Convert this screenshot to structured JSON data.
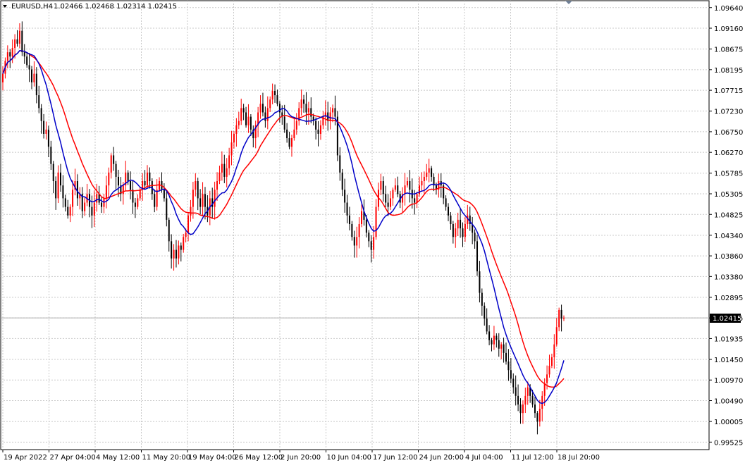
{
  "chart_data": {
    "type": "candlestick",
    "title": "EURUSD,H4",
    "ohlc_label": "1.02466 1.02468 1.02314 1.02415",
    "last_price": "1.02415",
    "ylim": [
      0.9935,
      1.098
    ],
    "y_ticks": [
      "1.09640",
      "1.09160",
      "1.08675",
      "1.08195",
      "1.07715",
      "1.07230",
      "1.06750",
      "1.06270",
      "1.05785",
      "1.05305",
      "1.04825",
      "1.04340",
      "1.03860",
      "1.03380",
      "1.02895",
      "1.02415",
      "1.01935",
      "1.01450",
      "1.00970",
      "1.00490",
      "1.00005",
      "0.99525"
    ],
    "x_ticks": [
      "19 Apr 2022",
      "27 Apr 04:00",
      "4 May 12:00",
      "11 May 20:00",
      "19 May 04:00",
      "26 May 12:00",
      "2 Jun 20:00",
      "10 Jun 04:00",
      "17 Jun 12:00",
      "24 Jun 20:00",
      "4 Jul 04:00",
      "11 Jul 12:00",
      "18 Jul 20:00"
    ],
    "grid": true,
    "up_color": "#ff0000",
    "down_color": "#000000",
    "close_series": [
      1.081,
      1.084,
      1.086,
      1.085,
      1.087,
      1.089,
      1.088,
      1.091,
      1.086,
      1.085,
      1.083,
      1.082,
      1.079,
      1.081,
      1.076,
      1.073,
      1.07,
      1.067,
      1.068,
      1.064,
      1.06,
      1.056,
      1.052,
      1.058,
      1.055,
      1.052,
      1.05,
      1.048,
      1.05,
      1.054,
      1.056,
      1.052,
      1.053,
      1.049,
      1.051,
      1.053,
      1.05,
      1.048,
      1.051,
      1.053,
      1.051,
      1.05,
      1.052,
      1.055,
      1.058,
      1.062,
      1.06,
      1.057,
      1.055,
      1.053,
      1.055,
      1.058,
      1.056,
      1.054,
      1.051,
      1.05,
      1.052,
      1.054,
      1.056,
      1.055,
      1.058,
      1.056,
      1.053,
      1.05,
      1.054,
      1.056,
      1.054,
      1.052,
      1.047,
      1.042,
      1.038,
      1.04,
      1.038,
      1.041,
      1.04,
      1.043,
      1.044,
      1.048,
      1.05,
      1.054,
      1.056,
      1.052,
      1.05,
      1.053,
      1.05,
      1.048,
      1.052,
      1.05,
      1.054,
      1.056,
      1.058,
      1.06,
      1.057,
      1.059,
      1.062,
      1.065,
      1.067,
      1.069,
      1.07,
      1.073,
      1.072,
      1.069,
      1.071,
      1.068,
      1.066,
      1.069,
      1.072,
      1.074,
      1.072,
      1.07,
      1.073,
      1.075,
      1.077,
      1.076,
      1.074,
      1.072,
      1.071,
      1.068,
      1.066,
      1.064,
      1.066,
      1.068,
      1.07,
      1.073,
      1.075,
      1.074,
      1.072,
      1.073,
      1.071,
      1.07,
      1.068,
      1.067,
      1.069,
      1.071,
      1.072,
      1.07,
      1.072,
      1.073,
      1.071,
      1.062,
      1.058,
      1.054,
      1.051,
      1.048,
      1.046,
      1.043,
      1.041,
      1.043,
      1.046,
      1.049,
      1.047,
      1.044,
      1.042,
      1.04,
      1.043,
      1.05,
      1.054,
      1.056,
      1.053,
      1.051,
      1.05,
      1.052,
      1.054,
      1.055,
      1.053,
      1.051,
      1.053,
      1.055,
      1.056,
      1.054,
      1.052,
      1.051,
      1.053,
      1.055,
      1.056,
      1.057,
      1.058,
      1.059,
      1.057,
      1.055,
      1.054,
      1.056,
      1.055,
      1.052,
      1.05,
      1.048,
      1.046,
      1.043,
      1.045,
      1.047,
      1.045,
      1.043,
      1.046,
      1.048,
      1.046,
      1.044,
      1.042,
      1.035,
      1.03,
      1.027,
      1.024,
      1.021,
      1.019,
      1.018,
      1.02,
      1.019,
      1.017,
      1.018,
      1.016,
      1.014,
      1.012,
      1.01,
      1.008,
      1.006,
      1.004,
      1.002,
      1.004,
      1.006,
      1.008,
      1.006,
      1.004,
      1.002,
      1.0,
      1.003,
      1.006,
      1.009,
      1.011,
      1.013,
      1.015,
      1.018,
      1.022,
      1.026,
      1.024,
      1.0242
    ]
  }
}
